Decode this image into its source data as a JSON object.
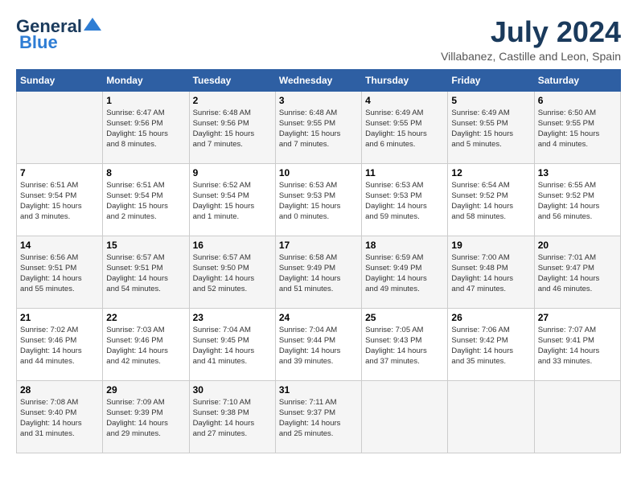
{
  "header": {
    "logo_line1": "General",
    "logo_line2": "Blue",
    "month_year": "July 2024",
    "location": "Villabanez, Castille and Leon, Spain"
  },
  "weekdays": [
    "Sunday",
    "Monday",
    "Tuesday",
    "Wednesday",
    "Thursday",
    "Friday",
    "Saturday"
  ],
  "weeks": [
    [
      {
        "day": "",
        "info": ""
      },
      {
        "day": "1",
        "info": "Sunrise: 6:47 AM\nSunset: 9:56 PM\nDaylight: 15 hours\nand 8 minutes."
      },
      {
        "day": "2",
        "info": "Sunrise: 6:48 AM\nSunset: 9:56 PM\nDaylight: 15 hours\nand 7 minutes."
      },
      {
        "day": "3",
        "info": "Sunrise: 6:48 AM\nSunset: 9:55 PM\nDaylight: 15 hours\nand 7 minutes."
      },
      {
        "day": "4",
        "info": "Sunrise: 6:49 AM\nSunset: 9:55 PM\nDaylight: 15 hours\nand 6 minutes."
      },
      {
        "day": "5",
        "info": "Sunrise: 6:49 AM\nSunset: 9:55 PM\nDaylight: 15 hours\nand 5 minutes."
      },
      {
        "day": "6",
        "info": "Sunrise: 6:50 AM\nSunset: 9:55 PM\nDaylight: 15 hours\nand 4 minutes."
      }
    ],
    [
      {
        "day": "7",
        "info": "Sunrise: 6:51 AM\nSunset: 9:54 PM\nDaylight: 15 hours\nand 3 minutes."
      },
      {
        "day": "8",
        "info": "Sunrise: 6:51 AM\nSunset: 9:54 PM\nDaylight: 15 hours\nand 2 minutes."
      },
      {
        "day": "9",
        "info": "Sunrise: 6:52 AM\nSunset: 9:54 PM\nDaylight: 15 hours\nand 1 minute."
      },
      {
        "day": "10",
        "info": "Sunrise: 6:53 AM\nSunset: 9:53 PM\nDaylight: 15 hours\nand 0 minutes."
      },
      {
        "day": "11",
        "info": "Sunrise: 6:53 AM\nSunset: 9:53 PM\nDaylight: 14 hours\nand 59 minutes."
      },
      {
        "day": "12",
        "info": "Sunrise: 6:54 AM\nSunset: 9:52 PM\nDaylight: 14 hours\nand 58 minutes."
      },
      {
        "day": "13",
        "info": "Sunrise: 6:55 AM\nSunset: 9:52 PM\nDaylight: 14 hours\nand 56 minutes."
      }
    ],
    [
      {
        "day": "14",
        "info": "Sunrise: 6:56 AM\nSunset: 9:51 PM\nDaylight: 14 hours\nand 55 minutes."
      },
      {
        "day": "15",
        "info": "Sunrise: 6:57 AM\nSunset: 9:51 PM\nDaylight: 14 hours\nand 54 minutes."
      },
      {
        "day": "16",
        "info": "Sunrise: 6:57 AM\nSunset: 9:50 PM\nDaylight: 14 hours\nand 52 minutes."
      },
      {
        "day": "17",
        "info": "Sunrise: 6:58 AM\nSunset: 9:49 PM\nDaylight: 14 hours\nand 51 minutes."
      },
      {
        "day": "18",
        "info": "Sunrise: 6:59 AM\nSunset: 9:49 PM\nDaylight: 14 hours\nand 49 minutes."
      },
      {
        "day": "19",
        "info": "Sunrise: 7:00 AM\nSunset: 9:48 PM\nDaylight: 14 hours\nand 47 minutes."
      },
      {
        "day": "20",
        "info": "Sunrise: 7:01 AM\nSunset: 9:47 PM\nDaylight: 14 hours\nand 46 minutes."
      }
    ],
    [
      {
        "day": "21",
        "info": "Sunrise: 7:02 AM\nSunset: 9:46 PM\nDaylight: 14 hours\nand 44 minutes."
      },
      {
        "day": "22",
        "info": "Sunrise: 7:03 AM\nSunset: 9:46 PM\nDaylight: 14 hours\nand 42 minutes."
      },
      {
        "day": "23",
        "info": "Sunrise: 7:04 AM\nSunset: 9:45 PM\nDaylight: 14 hours\nand 41 minutes."
      },
      {
        "day": "24",
        "info": "Sunrise: 7:04 AM\nSunset: 9:44 PM\nDaylight: 14 hours\nand 39 minutes."
      },
      {
        "day": "25",
        "info": "Sunrise: 7:05 AM\nSunset: 9:43 PM\nDaylight: 14 hours\nand 37 minutes."
      },
      {
        "day": "26",
        "info": "Sunrise: 7:06 AM\nSunset: 9:42 PM\nDaylight: 14 hours\nand 35 minutes."
      },
      {
        "day": "27",
        "info": "Sunrise: 7:07 AM\nSunset: 9:41 PM\nDaylight: 14 hours\nand 33 minutes."
      }
    ],
    [
      {
        "day": "28",
        "info": "Sunrise: 7:08 AM\nSunset: 9:40 PM\nDaylight: 14 hours\nand 31 minutes."
      },
      {
        "day": "29",
        "info": "Sunrise: 7:09 AM\nSunset: 9:39 PM\nDaylight: 14 hours\nand 29 minutes."
      },
      {
        "day": "30",
        "info": "Sunrise: 7:10 AM\nSunset: 9:38 PM\nDaylight: 14 hours\nand 27 minutes."
      },
      {
        "day": "31",
        "info": "Sunrise: 7:11 AM\nSunset: 9:37 PM\nDaylight: 14 hours\nand 25 minutes."
      },
      {
        "day": "",
        "info": ""
      },
      {
        "day": "",
        "info": ""
      },
      {
        "day": "",
        "info": ""
      }
    ]
  ]
}
